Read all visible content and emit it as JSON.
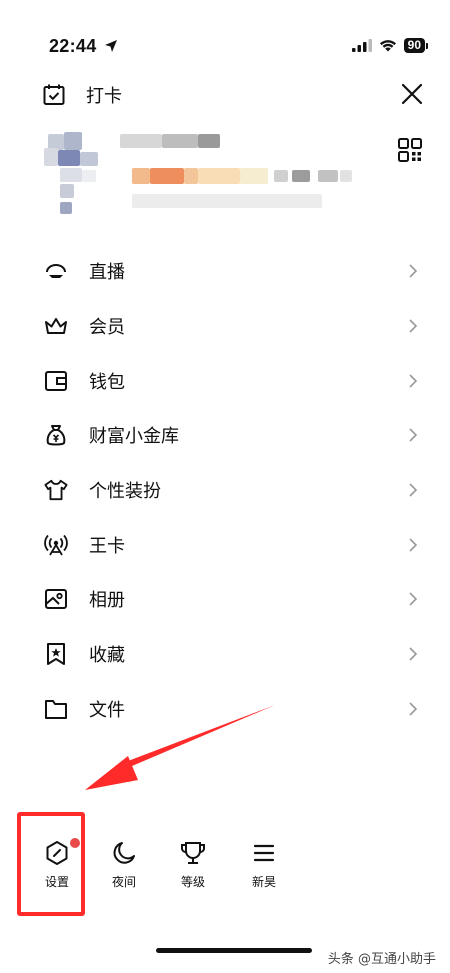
{
  "status_bar": {
    "time": "22:44",
    "battery": "90"
  },
  "header": {
    "checkin_label": "打卡"
  },
  "menu": [
    {
      "label": "直播",
      "icon": "live-icon"
    },
    {
      "label": "会员",
      "icon": "crown-icon"
    },
    {
      "label": "钱包",
      "icon": "wallet-icon"
    },
    {
      "label": "财富小金库",
      "icon": "money-bag-icon"
    },
    {
      "label": "个性装扮",
      "icon": "tshirt-icon"
    },
    {
      "label": "王卡",
      "icon": "signal-tower-icon"
    },
    {
      "label": "相册",
      "icon": "photo-album-icon"
    },
    {
      "label": "收藏",
      "icon": "bookmark-star-icon"
    },
    {
      "label": "文件",
      "icon": "folder-icon"
    }
  ],
  "bottom_bar": {
    "settings_label": "设置",
    "night_label": "夜间",
    "level_label": "等级",
    "more_label": "新昊"
  },
  "colors": {
    "annotation_red": "#ff2a2a",
    "badge_red": "#e84a4a"
  },
  "watermark": "头条 @互通小助手"
}
